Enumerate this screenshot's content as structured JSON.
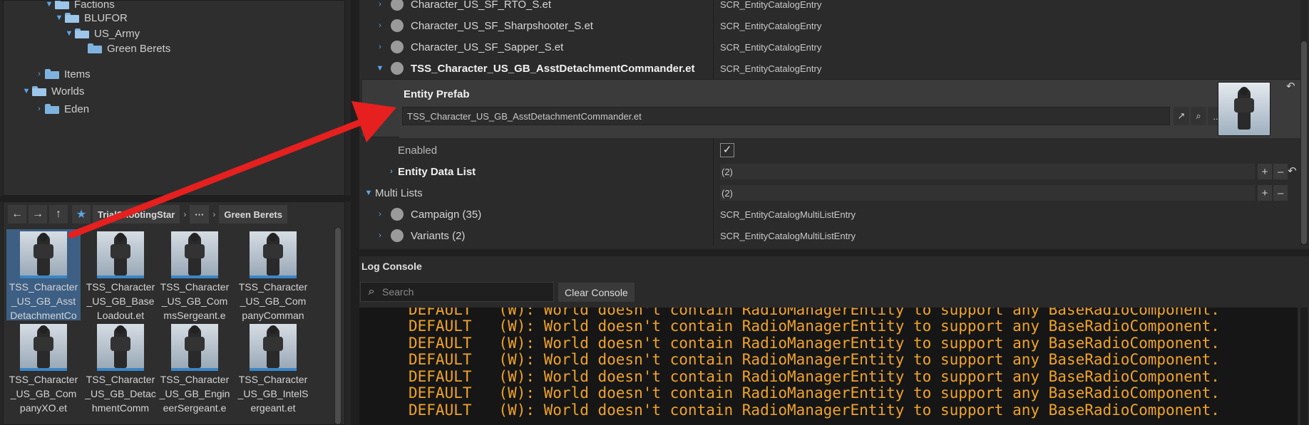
{
  "tree": {
    "items": [
      {
        "label": "Factions",
        "indent": 0,
        "expanded": true
      },
      {
        "label": "BLUFOR",
        "indent": 1,
        "expanded": true
      },
      {
        "label": "US_Army",
        "indent": 2,
        "expanded": true
      },
      {
        "label": "Green Berets",
        "indent": 3,
        "expanded": false
      },
      {
        "label": "Items",
        "indent": 0,
        "expanded": false
      },
      {
        "label": "Worlds",
        "indent": -1,
        "expanded": true
      },
      {
        "label": "Eden",
        "indent": 0,
        "expanded": false
      }
    ]
  },
  "browser": {
    "breadcrumb": {
      "first": "TrialShootingStar",
      "overflow": "···",
      "last": "Green Berets"
    },
    "tiles": [
      {
        "label": "TSS_Character_US_GB_AsstDetachmentCo",
        "selected": true
      },
      {
        "label": "TSS_Character_US_GB_BaseLoadout.et",
        "selected": false
      },
      {
        "label": "TSS_Character_US_GB_CommsSergeant.e",
        "selected": false
      },
      {
        "label": "TSS_Character_US_GB_CompanyComman",
        "selected": false
      },
      {
        "label": "TSS_Character_US_GB_CompanyXO.et",
        "selected": false
      },
      {
        "label": "TSS_Character_US_GB_DetachmentComm",
        "selected": false
      },
      {
        "label": "TSS_Character_US_GB_EngineerSergeant.e",
        "selected": false
      },
      {
        "label": "TSS_Character_US_GB_IntelSergeant.et",
        "selected": false
      }
    ]
  },
  "props": {
    "entries": [
      {
        "name": "Character_US_SF_RTO_S.et",
        "value": "SCR_EntityCatalogEntry"
      },
      {
        "name": "Character_US_SF_Sharpshooter_S.et",
        "value": "SCR_EntityCatalogEntry"
      },
      {
        "name": "Character_US_SF_Sapper_S.et",
        "value": "SCR_EntityCatalogEntry"
      },
      {
        "name": "TSS_Character_US_GB_AsstDetachmentCommander.et",
        "value": "SCR_EntityCatalogEntry"
      }
    ],
    "prefab": {
      "title": "Entity Prefab",
      "value": "TSS_Character_US_GB_AsstDetachmentCommander.et",
      "browse_label": ".."
    },
    "enabled_label": "Enabled",
    "entity_data_list": {
      "label": "Entity Data List",
      "value": "(2)"
    },
    "multi_lists": {
      "label": "Multi Lists",
      "value": "(2)"
    },
    "sub_entries": [
      {
        "name": "Campaign (35)",
        "value": "SCR_EntityCatalogMultiListEntry"
      },
      {
        "name": "Variants (2)",
        "value": "SCR_EntityCatalogMultiListEntry"
      }
    ]
  },
  "console": {
    "title": "Log Console",
    "search_placeholder": "Search",
    "clear_label": "Clear Console",
    "lines": [
      "DEFAULT   (W): World doesn't contain RadioManagerEntity to support any BaseRadioComponent.",
      "DEFAULT   (W): World doesn't contain RadioManagerEntity to support any BaseRadioComponent.",
      "DEFAULT   (W): World doesn't contain RadioManagerEntity to support any BaseRadioComponent.",
      "DEFAULT   (W): World doesn't contain RadioManagerEntity to support any BaseRadioComponent.",
      "DEFAULT   (W): World doesn't contain RadioManagerEntity to support any BaseRadioComponent.",
      "DEFAULT   (W): World doesn't contain RadioManagerEntity to support any BaseRadioComponent.",
      "DEFAULT   (W): World doesn't contain RadioManagerEntity to support any BaseRadioComponent."
    ],
    "line_color": "#f0a329"
  },
  "colors": {
    "accent": "#5aa6e8",
    "arrow": "#e5201f",
    "selection": "#3d5f84"
  }
}
